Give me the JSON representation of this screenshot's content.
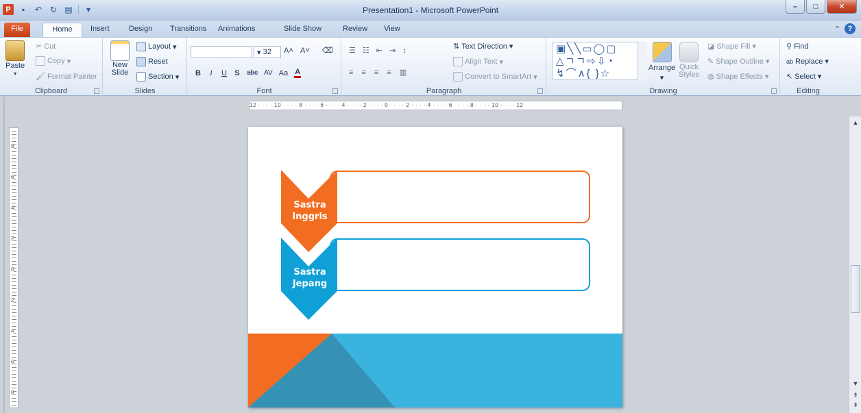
{
  "titlebar": {
    "title": "Presentation1 - Microsoft PowerPoint",
    "app_icon_letter": "P"
  },
  "tabs": {
    "file": "File",
    "items": [
      "Home",
      "Insert",
      "Design",
      "Transitions",
      "Animations",
      "Slide Show",
      "Review",
      "View"
    ],
    "active": "Home"
  },
  "ribbon": {
    "clipboard": {
      "label": "Clipboard",
      "paste": "Paste",
      "cut": "Cut",
      "copy": "Copy",
      "format_painter": "Format Painter"
    },
    "slides": {
      "label": "Slides",
      "new_slide": "New Slide",
      "layout": "Layout",
      "reset": "Reset",
      "section": "Section"
    },
    "font": {
      "label": "Font",
      "font_size": "32",
      "bold": "B",
      "italic": "I",
      "underline": "U",
      "shadow": "S",
      "strike": "abc",
      "spacing": "AV",
      "case": "Aa",
      "color": "A"
    },
    "paragraph": {
      "label": "Paragraph",
      "text_direction": "Text Direction",
      "align_text": "Align Text",
      "convert_smartart": "Convert to SmartArt"
    },
    "drawing": {
      "label": "Drawing",
      "arrange": "Arrange",
      "quick_styles": "Quick Styles",
      "shape_fill": "Shape Fill",
      "shape_outline": "Shape Outline",
      "shape_effects": "Shape Effects"
    },
    "editing": {
      "label": "Editing",
      "find": "Find",
      "replace": "Replace",
      "select": "Select"
    }
  },
  "ruler": {
    "horizontal": "12 · · · · 10 · · · · 8 · · · · 6 · · · · 4 · · · · 2 · · · · 0 · · · · 2 · · · · 4 · · · · 6 · · · · 8 · · · · 10 · · · · 12",
    "vertical_numbers": [
      "8",
      "6",
      "4",
      "2",
      "0",
      "2",
      "4",
      "6",
      "8"
    ]
  },
  "slide": {
    "items": [
      {
        "label_line1": "Sastra",
        "label_line2": "Inggris",
        "color": "#f26d21"
      },
      {
        "label_line1": "Sastra",
        "label_line2": "Jepang",
        "color": "#0fa1d6"
      }
    ],
    "footer_colors": {
      "blue": "#3bb3df",
      "orange": "#f26d21",
      "dark_blue": "#3592b4"
    }
  }
}
